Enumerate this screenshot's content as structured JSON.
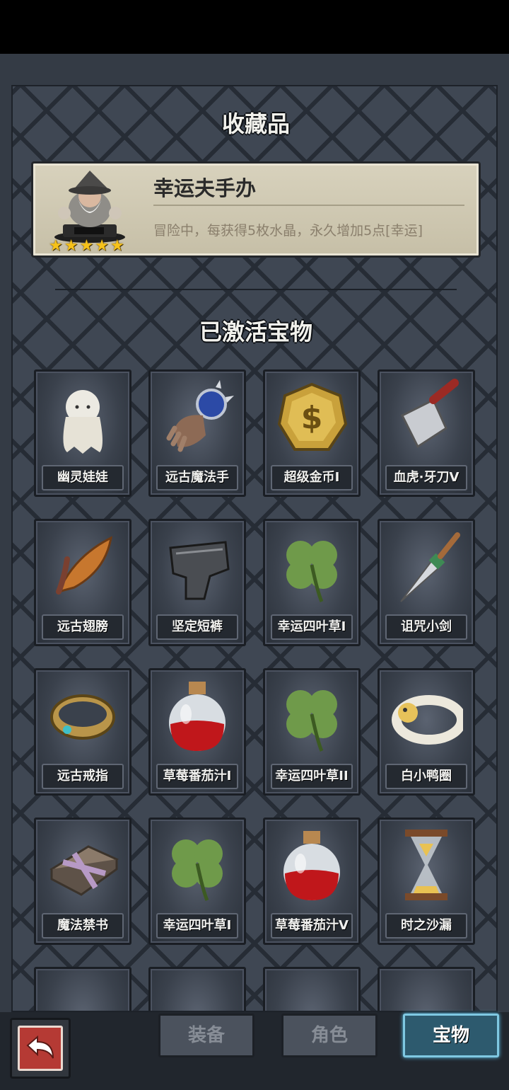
{
  "sections": {
    "collection_title": "收藏品",
    "activated_title": "已激活宝物"
  },
  "featured": {
    "name": "幸运夫手办",
    "description": "冒险中，每获得5枚水晶，永久增加5点[幸运]",
    "stars": 5
  },
  "items": [
    {
      "label": "幽灵娃娃",
      "icon": "ghost-doll-icon"
    },
    {
      "label": "远古魔法手",
      "icon": "magic-gauntlet-icon"
    },
    {
      "label": "超级金币I",
      "icon": "gold-coin-icon"
    },
    {
      "label": "血虎·牙刀V",
      "icon": "cleaver-icon"
    },
    {
      "label": "远古翅膀",
      "icon": "wing-icon"
    },
    {
      "label": "坚定短裤",
      "icon": "armor-shorts-icon"
    },
    {
      "label": "幸运四叶草I",
      "icon": "clover-icon"
    },
    {
      "label": "诅咒小剑",
      "icon": "dagger-icon"
    },
    {
      "label": "远古戒指",
      "icon": "ring-icon"
    },
    {
      "label": "草莓番茄汁I",
      "icon": "red-potion-icon"
    },
    {
      "label": "幸运四叶草II",
      "icon": "clover-icon"
    },
    {
      "label": "白小鸭圈",
      "icon": "duck-ring-icon"
    },
    {
      "label": "魔法禁书",
      "icon": "forbidden-book-icon"
    },
    {
      "label": "幸运四叶草I",
      "icon": "clover-icon"
    },
    {
      "label": "草莓番茄汁V",
      "icon": "red-potion-icon"
    },
    {
      "label": "时之沙漏",
      "icon": "hourglass-icon"
    }
  ],
  "tabs": [
    {
      "label": "装备",
      "active": false
    },
    {
      "label": "角色",
      "active": false
    },
    {
      "label": "宝物",
      "active": true
    }
  ],
  "colors": {
    "panel_bg": "#3f4753",
    "card_bg": "#d8d2bd",
    "star": "#f6c21a",
    "active_tab": "#2d5a6e",
    "back_button": "#b53a34"
  }
}
